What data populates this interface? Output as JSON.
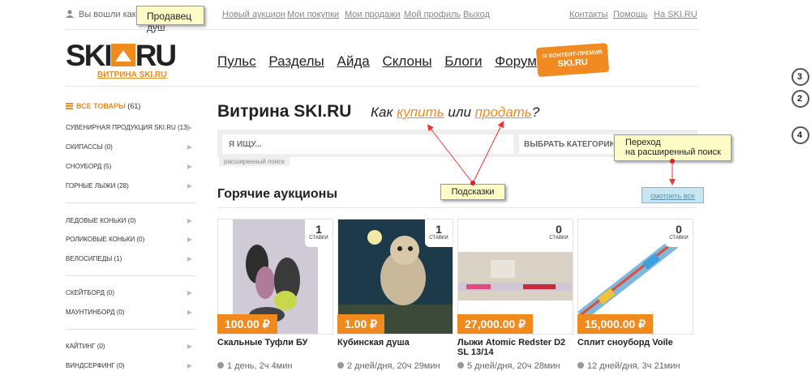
{
  "topbar": {
    "logged_in": "Вы вошли как:",
    "seller_note": "Продавец душ",
    "links": [
      "Новый аукцион",
      "Мои покупки",
      "Мои продажи",
      "Мой профиль",
      "Выход"
    ],
    "right_links": [
      "Контакты",
      "Помощь",
      "На SKI.RU"
    ]
  },
  "logo": {
    "main_left": "SKI",
    "main_right": "RU",
    "sub": "ВИТРИНА SKI.RU"
  },
  "nav": [
    "Пульс",
    "Разделы",
    "Айда",
    "Склоны",
    "Блоги",
    "Форум"
  ],
  "badge": {
    "line1": "IV КОНТЕНТ-ПРЕМИЯ",
    "line2": "SKI.RU"
  },
  "sidebar": {
    "all": {
      "label": "ВСЕ ТОВАРЫ",
      "count": "(61)"
    },
    "items": [
      "СУВЕНИРНАЯ ПРОДУКЦИЯ SKI.RU (13)",
      "СКИПАССЫ (0)",
      "СНОУБОРД (5)",
      "ГОРНЫЕ ЛЫЖИ (28)",
      "ЛЕДОВЫЕ КОНЬКИ (0)",
      "РОЛИКОВЫЕ КОНЬКИ (0)",
      "ВЕЛОСИПЕДЫ (1)",
      "СКЕЙТБОРД (0)",
      "МАУНТИНБОРД (0)",
      "КАЙТИНГ (0)",
      "ВИНДСЕРФИНГ (0)"
    ]
  },
  "main": {
    "title": "Витрина SKI.RU",
    "howto": {
      "pre": "Как",
      "buy": "купить",
      "mid": "или",
      "sell": "продать",
      "post": "?"
    },
    "search": {
      "placeholder": "Я ИЩУ...",
      "category": "ВЫБРАТЬ КАТЕГОРИЮ",
      "advanced": "расширенный поиск"
    },
    "notes": {
      "advanced_line1": "Переход",
      "advanced_line2": "на расширенный поиск",
      "hints": "Подсказки"
    },
    "section_title": "Горячие аукционы",
    "see_all": "смотреть все",
    "bids_label": "СТАВКИ",
    "products": [
      {
        "bids": "1",
        "price": "100.00 ₽",
        "title": "Скальные Туфли БУ",
        "time": "1 день, 2ч 4мин"
      },
      {
        "bids": "1",
        "price": "1.00 ₽",
        "title": "Кубинская душа",
        "time": "2 дней/дня, 20ч 29мин"
      },
      {
        "bids": "0",
        "price": "27,000.00 ₽",
        "title": "Лыжи Atomic Redster D2 SL 13/14",
        "time": "5 дней/дня, 20ч 28мин"
      },
      {
        "bids": "0",
        "price": "15,000.00 ₽",
        "title": "Сплит сноуборд Voile",
        "time": "12 дней/дня, 3ч 21мин"
      }
    ]
  },
  "side_circles": [
    "3",
    "2",
    "4"
  ],
  "colors": {
    "accent": "#f08a1c",
    "note_bg": "#fdfbc6",
    "see_all_bg": "#c7e6f2"
  }
}
